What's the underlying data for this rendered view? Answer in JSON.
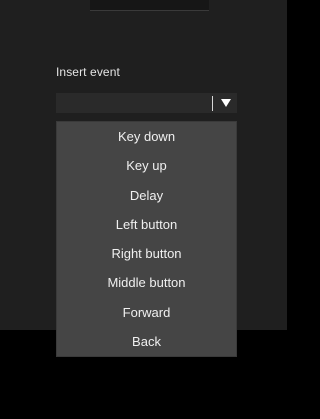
{
  "section": {
    "label": "Insert event"
  },
  "combo": {
    "value": "",
    "arrow_icon": "triangle-down-icon"
  },
  "dropdown": {
    "items": [
      {
        "label": "Key down"
      },
      {
        "label": "Key up"
      },
      {
        "label": "Delay"
      },
      {
        "label": "Left button"
      },
      {
        "label": "Right button"
      },
      {
        "label": "Middle button"
      },
      {
        "label": "Forward"
      },
      {
        "label": "Back"
      }
    ]
  },
  "colors": {
    "panel_bg": "#1f1f1f",
    "dropdown_bg": "#454545",
    "text": "#f0f0f0",
    "page_bg": "#000000"
  }
}
